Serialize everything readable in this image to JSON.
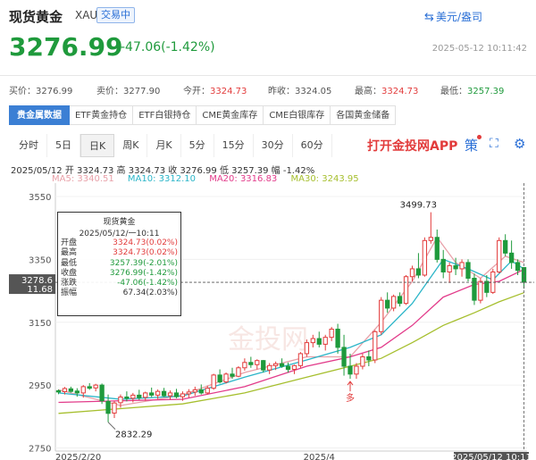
{
  "header": {
    "title": "现货黄金",
    "symbol": "XAU",
    "status_badge": "交易中",
    "unit_label": "美元/盎司",
    "price": "3276.99",
    "change": "-47.06(-1.42%)",
    "timestamp": "2025-05-12 10:11:42"
  },
  "quote": [
    {
      "label": "买价：",
      "value": "3276.99",
      "color": "normal"
    },
    {
      "label": "卖价：",
      "value": "3277.90",
      "color": "normal"
    },
    {
      "label": "今开：",
      "value": "3324.73",
      "color": "red"
    },
    {
      "label": "昨收：",
      "value": "3324.05",
      "color": "normal"
    },
    {
      "label": "最高：",
      "value": "3324.73",
      "color": "red"
    },
    {
      "label": "最低：",
      "value": "3257.39",
      "color": "green"
    }
  ],
  "tabs": [
    "贵金属数据",
    "ETF黄金持仓",
    "ETF白银持仓",
    "CME黄金库存",
    "CME白银库存",
    "各国黄金储备"
  ],
  "periods": [
    "分时",
    "5日",
    "日K",
    "周K",
    "月K",
    "5分",
    "15分",
    "30分",
    "60分"
  ],
  "active_period": "日K",
  "app_link": "打开金投网APP",
  "strategy_label": "策",
  "ohlc_line": "2025/05/12  开 3324.73  高 3324.73  收 3276.99  低 3257.39  幅 -1.42%",
  "ma_values": [
    {
      "label": "MA5: 3340.51",
      "color": "#e8a0a8"
    },
    {
      "label": "MA10: 3312.10",
      "color": "#2ab5c8"
    },
    {
      "label": "MA20: 3316.83",
      "color": "#e23b8a"
    },
    {
      "label": "MA30: 3243.95",
      "color": "#a6bf2e"
    }
  ],
  "tooltip": {
    "title": "现货黄金",
    "date": "2025/05/12/一10:11",
    "rows": [
      {
        "label": "开盘",
        "value": "3324.73(0.02%)",
        "color": "red"
      },
      {
        "label": "最高",
        "value": "3324.73(0.02%)",
        "color": "red"
      },
      {
        "label": "最低",
        "value": "3257.39(-2.01%)",
        "color": "green"
      },
      {
        "label": "收盘",
        "value": "3276.99(-1.42%)",
        "color": "green"
      },
      {
        "label": "涨跌",
        "value": "-47.06(-1.42%)",
        "color": "green"
      },
      {
        "label": "振幅",
        "value": "67.34(2.03%)",
        "color": "normal"
      }
    ]
  },
  "watermark": "金投网",
  "colors": {
    "up": "#e23b3b",
    "down": "#1f9a3c",
    "accent": "#2a6fd6",
    "tab_active": "#3b7fd4"
  },
  "chart_data": {
    "type": "candlestick",
    "y_ticks": [
      2750,
      2950,
      3150,
      3350,
      3550
    ],
    "ylim": [
      2740,
      3570
    ],
    "x_labels": [
      "2025/2/20",
      "2025/4",
      "2025/05/12 10:11"
    ],
    "crosshair_price": "3278.6",
    "crosshair_sub": "11.68",
    "annotations": {
      "high": "3499.73",
      "low": "2832.29",
      "marker": "多"
    },
    "candles": [
      [
        2932,
        2936,
        2921,
        2928
      ],
      [
        2929,
        2944,
        2920,
        2939
      ],
      [
        2938,
        2945,
        2926,
        2930
      ],
      [
        2931,
        2940,
        2913,
        2925
      ],
      [
        2925,
        2950,
        2910,
        2945
      ],
      [
        2945,
        2956,
        2935,
        2940
      ],
      [
        2941,
        2954,
        2930,
        2950
      ],
      [
        2950,
        2955,
        2890,
        2900
      ],
      [
        2898,
        2920,
        2832,
        2860
      ],
      [
        2861,
        2899,
        2845,
        2893
      ],
      [
        2894,
        2920,
        2878,
        2912
      ],
      [
        2912,
        2930,
        2898,
        2908
      ],
      [
        2908,
        2925,
        2895,
        2918
      ],
      [
        2918,
        2935,
        2903,
        2910
      ],
      [
        2911,
        2929,
        2900,
        2925
      ],
      [
        2925,
        2942,
        2912,
        2918
      ],
      [
        2918,
        2936,
        2906,
        2930
      ],
      [
        2930,
        2941,
        2912,
        2916
      ],
      [
        2916,
        2933,
        2904,
        2925
      ],
      [
        2925,
        2938,
        2908,
        2913
      ],
      [
        2913,
        2930,
        2900,
        2922
      ],
      [
        2922,
        2937,
        2910,
        2928
      ],
      [
        2928,
        2945,
        2916,
        2935
      ],
      [
        2935,
        2952,
        2920,
        2925
      ],
      [
        2925,
        2948,
        2920,
        2940
      ],
      [
        2940,
        2986,
        2935,
        2982
      ],
      [
        2982,
        3000,
        2955,
        2960
      ],
      [
        2960,
        2990,
        2955,
        2985
      ],
      [
        2985,
        3005,
        2970,
        2978
      ],
      [
        2978,
        3010,
        2975,
        3005
      ],
      [
        3005,
        3035,
        2996,
        3022
      ],
      [
        3022,
        3040,
        3005,
        3015
      ],
      [
        3015,
        3032,
        3000,
        3028
      ],
      [
        3028,
        3030,
        2990,
        2998
      ],
      [
        2998,
        3020,
        2985,
        3012
      ],
      [
        3012,
        3025,
        2998,
        3018
      ],
      [
        3018,
        3035,
        3005,
        3010
      ],
      [
        3010,
        3022,
        2990,
        3000
      ],
      [
        3000,
        3015,
        2985,
        3012
      ],
      [
        3012,
        3055,
        3005,
        3050
      ],
      [
        3050,
        3095,
        3040,
        3085
      ],
      [
        3085,
        3110,
        3070,
        3098
      ],
      [
        3098,
        3120,
        3070,
        3080
      ],
      [
        3080,
        3110,
        3060,
        3102
      ],
      [
        3102,
        3135,
        3090,
        3128
      ],
      [
        3128,
        3145,
        3050,
        3070
      ],
      [
        3070,
        3110,
        2980,
        3010
      ],
      [
        3010,
        3050,
        2970,
        2985
      ],
      [
        2985,
        3020,
        2970,
        3010
      ],
      [
        3010,
        3050,
        3000,
        3040
      ],
      [
        3040,
        3060,
        3010,
        3030
      ],
      [
        3030,
        3125,
        3020,
        3120
      ],
      [
        3120,
        3230,
        3110,
        3220
      ],
      [
        3220,
        3245,
        3180,
        3195
      ],
      [
        3195,
        3238,
        3185,
        3232
      ],
      [
        3232,
        3245,
        3200,
        3210
      ],
      [
        3210,
        3300,
        3205,
        3295
      ],
      [
        3295,
        3330,
        3280,
        3320
      ],
      [
        3320,
        3370,
        3290,
        3300
      ],
      [
        3300,
        3420,
        3295,
        3410
      ],
      [
        3410,
        3500,
        3400,
        3420
      ],
      [
        3420,
        3445,
        3340,
        3350
      ],
      [
        3350,
        3380,
        3290,
        3310
      ],
      [
        3310,
        3340,
        3275,
        3330
      ],
      [
        3330,
        3355,
        3300,
        3320
      ],
      [
        3320,
        3350,
        3295,
        3340
      ],
      [
        3340,
        3350,
        3280,
        3290
      ],
      [
        3290,
        3305,
        3205,
        3220
      ],
      [
        3220,
        3290,
        3210,
        3280
      ],
      [
        3280,
        3300,
        3230,
        3245
      ],
      [
        3245,
        3320,
        3240,
        3310
      ],
      [
        3310,
        3420,
        3305,
        3410
      ],
      [
        3410,
        3430,
        3360,
        3370
      ],
      [
        3370,
        3410,
        3320,
        3340
      ],
      [
        3340,
        3350,
        3300,
        3315
      ],
      [
        3324,
        3325,
        3257,
        3277
      ]
    ],
    "ma_series": {
      "ma5": [
        [
          0,
          2935
        ],
        [
          10,
          2885
        ],
        [
          20,
          2918
        ],
        [
          30,
          2990
        ],
        [
          40,
          3040
        ],
        [
          47,
          3040
        ],
        [
          52,
          3150
        ],
        [
          57,
          3280
        ],
        [
          61,
          3420
        ],
        [
          64,
          3340
        ],
        [
          68,
          3290
        ],
        [
          72,
          3360
        ],
        [
          75,
          3340
        ]
      ],
      "ma10": [
        [
          0,
          2925
        ],
        [
          10,
          2905
        ],
        [
          20,
          2915
        ],
        [
          30,
          2975
        ],
        [
          40,
          3030
        ],
        [
          47,
          3070
        ],
        [
          52,
          3110
        ],
        [
          57,
          3210
        ],
        [
          62,
          3350
        ],
        [
          66,
          3320
        ],
        [
          70,
          3285
        ],
        [
          73,
          3345
        ],
        [
          75,
          3320
        ]
      ],
      "ma20": [
        [
          0,
          2895
        ],
        [
          10,
          2900
        ],
        [
          20,
          2905
        ],
        [
          30,
          2945
        ],
        [
          40,
          3010
        ],
        [
          47,
          3040
        ],
        [
          52,
          3070
        ],
        [
          57,
          3140
        ],
        [
          62,
          3230
        ],
        [
          67,
          3270
        ],
        [
          71,
          3280
        ],
        [
          75,
          3318
        ]
      ],
      "ma30": [
        [
          0,
          2860
        ],
        [
          10,
          2875
        ],
        [
          20,
          2890
        ],
        [
          30,
          2925
        ],
        [
          40,
          2975
        ],
        [
          47,
          3010
        ],
        [
          52,
          3035
        ],
        [
          57,
          3085
        ],
        [
          62,
          3140
        ],
        [
          67,
          3180
        ],
        [
          71,
          3215
        ],
        [
          75,
          3244
        ]
      ]
    }
  }
}
